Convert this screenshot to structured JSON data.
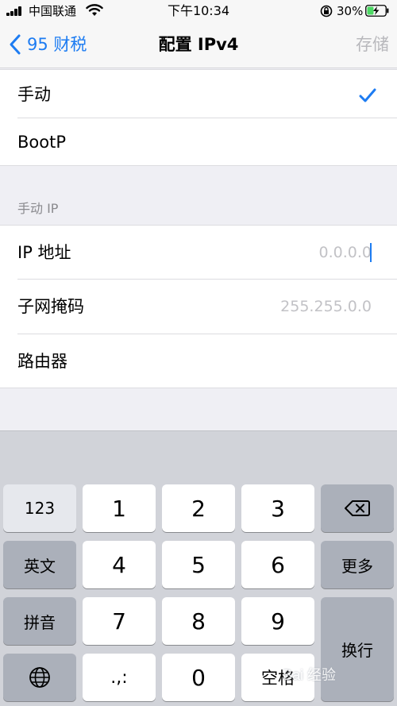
{
  "status_bar": {
    "carrier": "中国联通",
    "time": "下午10:34",
    "battery": "30%"
  },
  "nav": {
    "back_label": "95 财税",
    "title": "配置 IPv4",
    "save_label": "存储"
  },
  "config_options": [
    {
      "label": "手动",
      "selected": true
    },
    {
      "label": "BootP",
      "selected": false
    }
  ],
  "manual_section": {
    "header": "手动 IP",
    "fields": [
      {
        "label": "IP 地址",
        "value": "",
        "placeholder": "0.0.0.0"
      },
      {
        "label": "子网掩码",
        "value": "",
        "placeholder": "255.255.0.0"
      },
      {
        "label": "路由器",
        "value": "",
        "placeholder": ""
      }
    ]
  },
  "keyboard": {
    "mode_123": "123",
    "english": "英文",
    "pinyin": "拼音",
    "more": "更多",
    "return": "换行",
    "space": "空格",
    "punct": ".,:",
    "digits": [
      "1",
      "2",
      "3",
      "4",
      "5",
      "6",
      "7",
      "8",
      "9",
      "0"
    ]
  },
  "watermark": "Bai 经验",
  "colors": {
    "accent": "#1d7cf2",
    "background": "#efeff4",
    "keyboard_bg": "#d1d3d9"
  }
}
